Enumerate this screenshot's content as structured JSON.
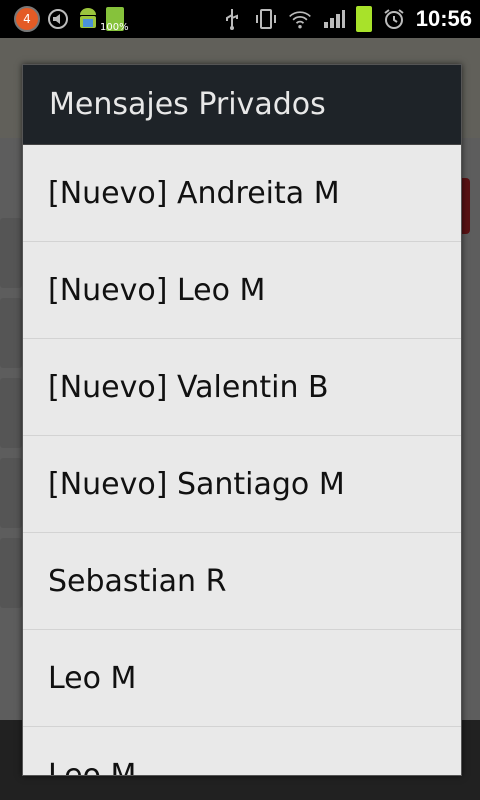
{
  "status_bar": {
    "notification_count": "4",
    "battery_percent_text": "100%",
    "time": "10:56",
    "icons": [
      "notification-icon",
      "volume-mute-icon",
      "android-icon",
      "battery-icon",
      "usb-icon",
      "vibrate-icon",
      "wifi-icon",
      "signal-icon",
      "battery-full-icon",
      "alarm-icon"
    ]
  },
  "dialog": {
    "title": "Mensajes Privados",
    "items": [
      "[Nuevo] Andreita M",
      "[Nuevo] Leo M",
      "[Nuevo] Valentin B",
      "[Nuevo] Santiago M",
      "Sebastian R",
      "Leo M",
      "Leo M"
    ]
  },
  "colors": {
    "title_bar": "#1e2328",
    "list_background": "#e9e9e9",
    "clock": "#ffffff"
  }
}
